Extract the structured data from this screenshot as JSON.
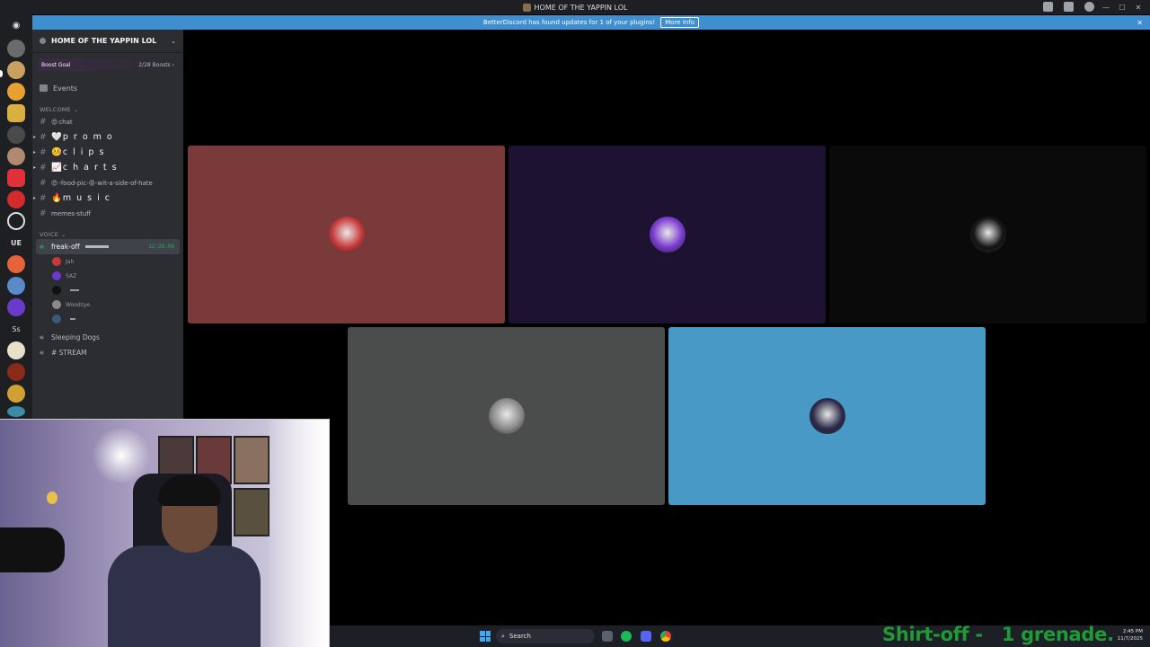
{
  "window": {
    "title": "HOME OF THE YAPPIN LOL",
    "controls": [
      "minimize",
      "maximize",
      "close"
    ]
  },
  "notice": {
    "text": "BetterDiscord has found updates for 1 of your plugins!",
    "button": "More Info"
  },
  "server": {
    "name": "HOME OF THE YAPPIN LOL",
    "boost_label": "Boost Goal",
    "boost_count": "2/28 Boosts",
    "events_label": "Events"
  },
  "categories": {
    "welcome": "WELCOME",
    "voice": "VOICE"
  },
  "text_channels": [
    {
      "icon": "😍",
      "name": "chat"
    },
    {
      "icon": "🤍",
      "name": "p r o m o"
    },
    {
      "icon": "🤒",
      "name": "c l i p s"
    },
    {
      "icon": "📈",
      "name": "c h a r t s"
    },
    {
      "icon": "😍",
      "name": "-food-pic-😡-wit-a-side-of-hate"
    },
    {
      "icon": "🔥",
      "name": "m u s i c"
    },
    {
      "icon": "",
      "name": "memes-stuff"
    }
  ],
  "voice": {
    "active_channel": "freak-off",
    "active_time": "32:28:08",
    "users": [
      "Jah",
      "SAZ",
      "",
      "Woodzye",
      ""
    ],
    "other_channels": [
      "Sleeping Dogs",
      "# STREAM"
    ]
  },
  "server_icons": {
    "ss_label": "Ss",
    "ue_label": "UE"
  },
  "tiles": [
    {
      "bg": "#7a3a3a",
      "avatar_color": "#c83a3a"
    },
    {
      "bg": "#1e1233",
      "avatar_color": "#7a3ad0"
    },
    {
      "bg": "#0a0a0a",
      "avatar_color": "#141414"
    },
    {
      "bg": "#4b4d4c",
      "avatar_color": "#8a8a8a"
    },
    {
      "bg": "#4999c6",
      "avatar_color": "#2c2a4a"
    }
  ],
  "taskbar": {
    "search_placeholder": "Search",
    "time": "2:45 PM",
    "date": "11/7/2025"
  },
  "overlay": {
    "text": "Shirt-off -   1 grenade."
  }
}
